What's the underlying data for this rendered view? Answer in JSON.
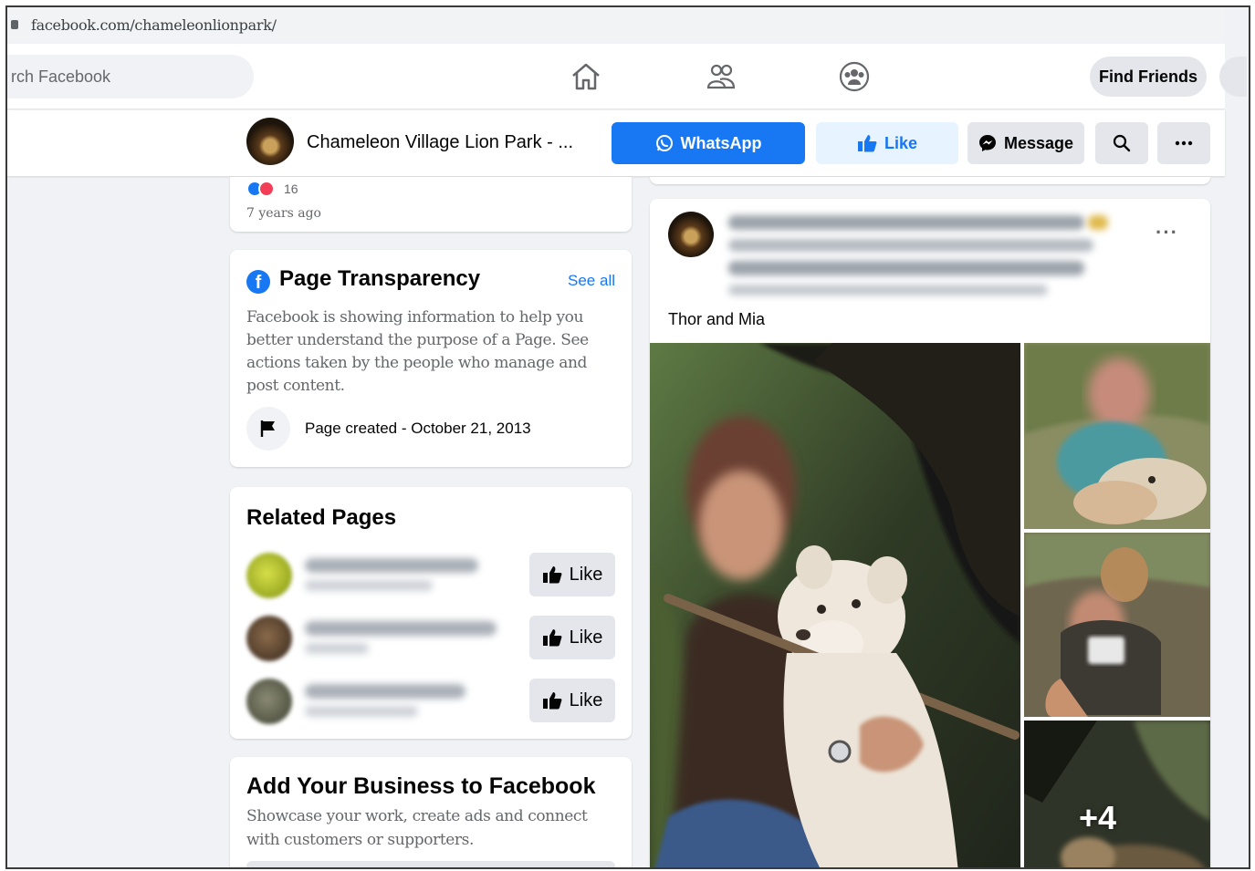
{
  "browser": {
    "url": "facebook.com/chameleonlionpark/"
  },
  "topnav": {
    "search_placeholder": "rch Facebook",
    "find_friends": "Find Friends"
  },
  "pagebar": {
    "page_name": "Chameleon Village Lion Park - ...",
    "whatsapp_label": "WhatsApp",
    "like_label": "Like",
    "message_label": "Message"
  },
  "prev_post": {
    "reaction_count": "16",
    "time_ago": "7 years ago"
  },
  "transparency": {
    "title": "Page Transparency",
    "see_all": "See all",
    "description": "Facebook is showing information to help you better understand the purpose of a Page. See actions taken by the people who manage and post content.",
    "page_created": "Page created - October 21, 2013"
  },
  "related_pages": {
    "title": "Related Pages",
    "items": [
      {
        "like_label": "Like"
      },
      {
        "like_label": "Like"
      },
      {
        "like_label": "Like"
      }
    ]
  },
  "add_business": {
    "title": "Add Your Business to Facebook",
    "description": "Showcase your work, create ads and connect with customers or supporters."
  },
  "post": {
    "caption": "Thor and Mia",
    "more_photos": "+4"
  },
  "colors": {
    "brand_blue": "#1877f2",
    "light_blue": "#e7f3ff",
    "grey_button": "#e4e6eb",
    "background": "#f0f2f5"
  }
}
